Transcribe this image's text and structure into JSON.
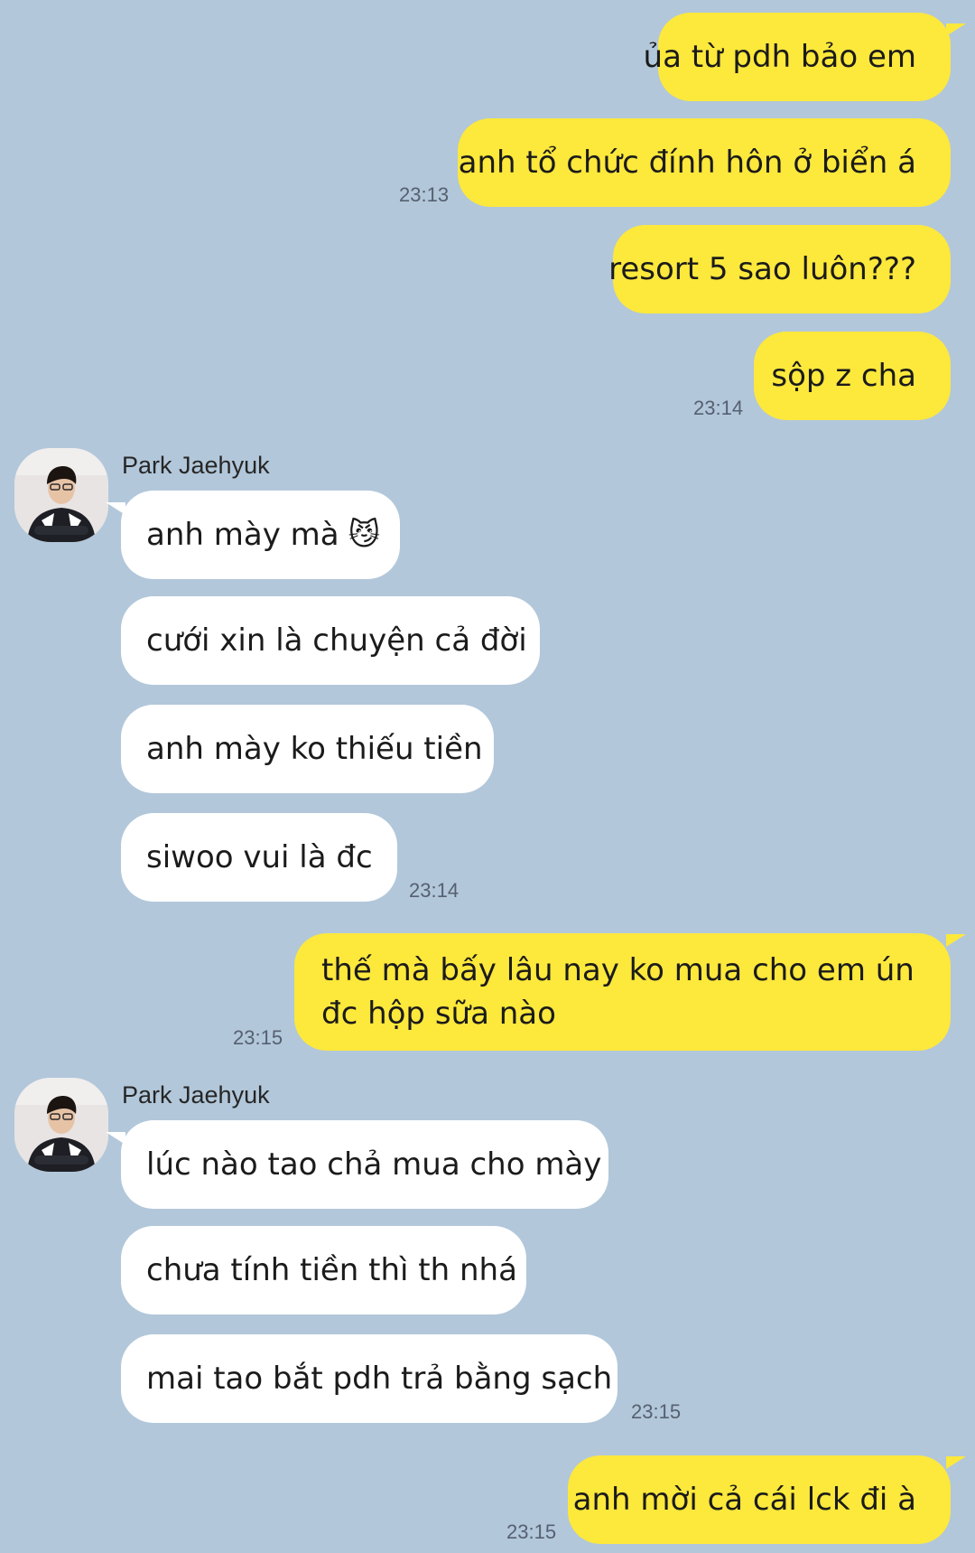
{
  "chat": {
    "sender_name": "Park Jaehyuk",
    "messages_me_1": [
      "ủa từ pdh bảo em",
      "anh tổ chức đính hôn ở biển á",
      "resort 5 sao luôn???",
      "sộp z cha"
    ],
    "times": {
      "t1": "23:13",
      "t2": "23:14",
      "t3": "23:14",
      "t4": "23:15",
      "t5": "23:15",
      "t6": "23:15"
    },
    "messages_them_1": [
      "anh mày mà",
      "cưới xin là chuyện cả đời",
      "anh mày ko thiếu tiền",
      "siwoo vui là đc"
    ],
    "emoji_1": "😼",
    "messages_me_2": "thế mà bấy lâu nay ko mua cho em ún đc hộp sữa nào",
    "messages_them_2": [
      "lúc nào tao chả mua cho mày",
      "chưa tính tiền thì th nhá",
      "mai tao bắt pdh trả bằng sạch"
    ],
    "messages_me_3": "anh mời cả cái lck đi à"
  },
  "colors": {
    "background": "#b2c7da",
    "my_bubble": "#fde83c",
    "their_bubble": "#ffffff"
  }
}
